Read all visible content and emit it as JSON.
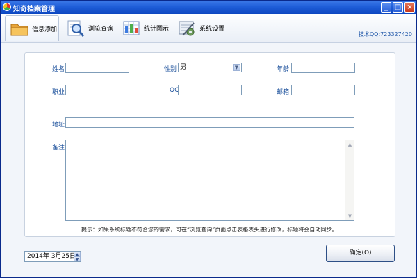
{
  "window": {
    "title": "知奇档案管理",
    "controls": {
      "minimize": "_",
      "maximize": "□",
      "close": "×"
    }
  },
  "toolbar": {
    "items": [
      {
        "label": "信息添加",
        "icon": "folder-icon",
        "active": true
      },
      {
        "label": "浏览查询",
        "icon": "magnifier-icon",
        "active": false
      },
      {
        "label": "统计图示",
        "icon": "chart-sheet-icon",
        "active": false
      },
      {
        "label": "系统设置",
        "icon": "settings-icon",
        "active": false
      }
    ],
    "tech_label": "技术QQ:723327420"
  },
  "form": {
    "name_label": "姓名",
    "name_value": "",
    "gender_label": "性别",
    "gender_value": "男",
    "age_label": "年龄",
    "age_value": "",
    "job_label": "职业",
    "job_value": "",
    "qq_label": "QQ",
    "qq_value": "",
    "email_label": "邮箱",
    "email_value": "",
    "address_label": "地址",
    "address_value": "",
    "note_label": "备注",
    "note_value": ""
  },
  "hint": "提示：如果系统标题不符合您的需求，可在“浏览查询”页面点击表格表头进行修改，标题将会自动同步。",
  "footer": {
    "date_value": "2014年  3月25日",
    "ok_label": "确定(O)"
  }
}
